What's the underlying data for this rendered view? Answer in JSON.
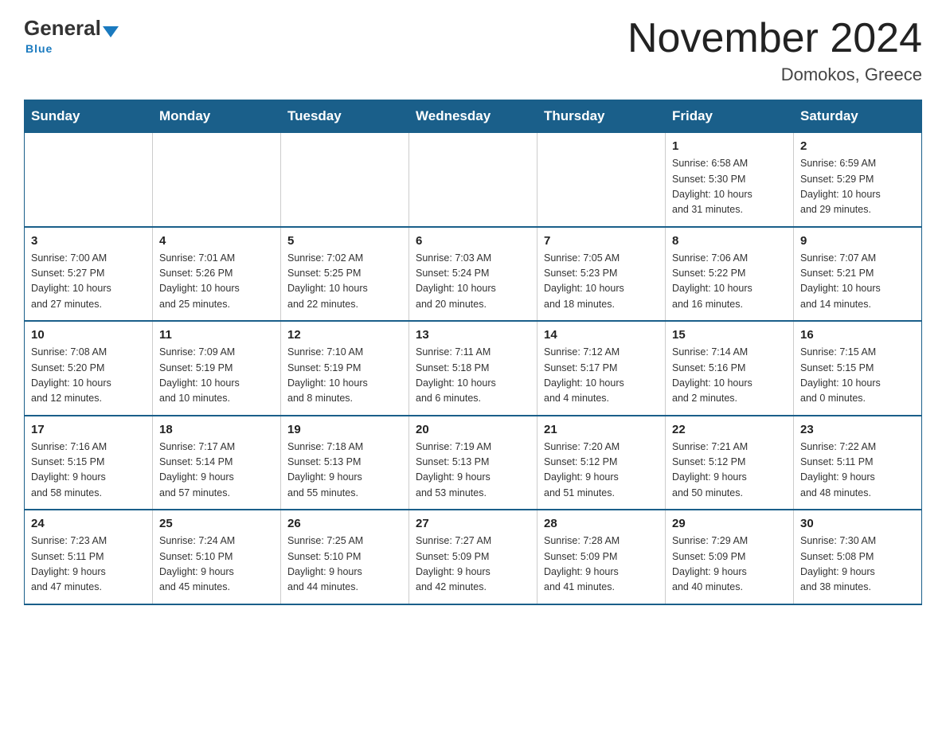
{
  "header": {
    "logo_general": "General",
    "logo_blue": "Blue",
    "main_title": "November 2024",
    "subtitle": "Domokos, Greece"
  },
  "days_of_week": [
    "Sunday",
    "Monday",
    "Tuesday",
    "Wednesday",
    "Thursday",
    "Friday",
    "Saturday"
  ],
  "weeks": [
    [
      {
        "day": "",
        "info": ""
      },
      {
        "day": "",
        "info": ""
      },
      {
        "day": "",
        "info": ""
      },
      {
        "day": "",
        "info": ""
      },
      {
        "day": "",
        "info": ""
      },
      {
        "day": "1",
        "info": "Sunrise: 6:58 AM\nSunset: 5:30 PM\nDaylight: 10 hours\nand 31 minutes."
      },
      {
        "day": "2",
        "info": "Sunrise: 6:59 AM\nSunset: 5:29 PM\nDaylight: 10 hours\nand 29 minutes."
      }
    ],
    [
      {
        "day": "3",
        "info": "Sunrise: 7:00 AM\nSunset: 5:27 PM\nDaylight: 10 hours\nand 27 minutes."
      },
      {
        "day": "4",
        "info": "Sunrise: 7:01 AM\nSunset: 5:26 PM\nDaylight: 10 hours\nand 25 minutes."
      },
      {
        "day": "5",
        "info": "Sunrise: 7:02 AM\nSunset: 5:25 PM\nDaylight: 10 hours\nand 22 minutes."
      },
      {
        "day": "6",
        "info": "Sunrise: 7:03 AM\nSunset: 5:24 PM\nDaylight: 10 hours\nand 20 minutes."
      },
      {
        "day": "7",
        "info": "Sunrise: 7:05 AM\nSunset: 5:23 PM\nDaylight: 10 hours\nand 18 minutes."
      },
      {
        "day": "8",
        "info": "Sunrise: 7:06 AM\nSunset: 5:22 PM\nDaylight: 10 hours\nand 16 minutes."
      },
      {
        "day": "9",
        "info": "Sunrise: 7:07 AM\nSunset: 5:21 PM\nDaylight: 10 hours\nand 14 minutes."
      }
    ],
    [
      {
        "day": "10",
        "info": "Sunrise: 7:08 AM\nSunset: 5:20 PM\nDaylight: 10 hours\nand 12 minutes."
      },
      {
        "day": "11",
        "info": "Sunrise: 7:09 AM\nSunset: 5:19 PM\nDaylight: 10 hours\nand 10 minutes."
      },
      {
        "day": "12",
        "info": "Sunrise: 7:10 AM\nSunset: 5:19 PM\nDaylight: 10 hours\nand 8 minutes."
      },
      {
        "day": "13",
        "info": "Sunrise: 7:11 AM\nSunset: 5:18 PM\nDaylight: 10 hours\nand 6 minutes."
      },
      {
        "day": "14",
        "info": "Sunrise: 7:12 AM\nSunset: 5:17 PM\nDaylight: 10 hours\nand 4 minutes."
      },
      {
        "day": "15",
        "info": "Sunrise: 7:14 AM\nSunset: 5:16 PM\nDaylight: 10 hours\nand 2 minutes."
      },
      {
        "day": "16",
        "info": "Sunrise: 7:15 AM\nSunset: 5:15 PM\nDaylight: 10 hours\nand 0 minutes."
      }
    ],
    [
      {
        "day": "17",
        "info": "Sunrise: 7:16 AM\nSunset: 5:15 PM\nDaylight: 9 hours\nand 58 minutes."
      },
      {
        "day": "18",
        "info": "Sunrise: 7:17 AM\nSunset: 5:14 PM\nDaylight: 9 hours\nand 57 minutes."
      },
      {
        "day": "19",
        "info": "Sunrise: 7:18 AM\nSunset: 5:13 PM\nDaylight: 9 hours\nand 55 minutes."
      },
      {
        "day": "20",
        "info": "Sunrise: 7:19 AM\nSunset: 5:13 PM\nDaylight: 9 hours\nand 53 minutes."
      },
      {
        "day": "21",
        "info": "Sunrise: 7:20 AM\nSunset: 5:12 PM\nDaylight: 9 hours\nand 51 minutes."
      },
      {
        "day": "22",
        "info": "Sunrise: 7:21 AM\nSunset: 5:12 PM\nDaylight: 9 hours\nand 50 minutes."
      },
      {
        "day": "23",
        "info": "Sunrise: 7:22 AM\nSunset: 5:11 PM\nDaylight: 9 hours\nand 48 minutes."
      }
    ],
    [
      {
        "day": "24",
        "info": "Sunrise: 7:23 AM\nSunset: 5:11 PM\nDaylight: 9 hours\nand 47 minutes."
      },
      {
        "day": "25",
        "info": "Sunrise: 7:24 AM\nSunset: 5:10 PM\nDaylight: 9 hours\nand 45 minutes."
      },
      {
        "day": "26",
        "info": "Sunrise: 7:25 AM\nSunset: 5:10 PM\nDaylight: 9 hours\nand 44 minutes."
      },
      {
        "day": "27",
        "info": "Sunrise: 7:27 AM\nSunset: 5:09 PM\nDaylight: 9 hours\nand 42 minutes."
      },
      {
        "day": "28",
        "info": "Sunrise: 7:28 AM\nSunset: 5:09 PM\nDaylight: 9 hours\nand 41 minutes."
      },
      {
        "day": "29",
        "info": "Sunrise: 7:29 AM\nSunset: 5:09 PM\nDaylight: 9 hours\nand 40 minutes."
      },
      {
        "day": "30",
        "info": "Sunrise: 7:30 AM\nSunset: 5:08 PM\nDaylight: 9 hours\nand 38 minutes."
      }
    ]
  ]
}
